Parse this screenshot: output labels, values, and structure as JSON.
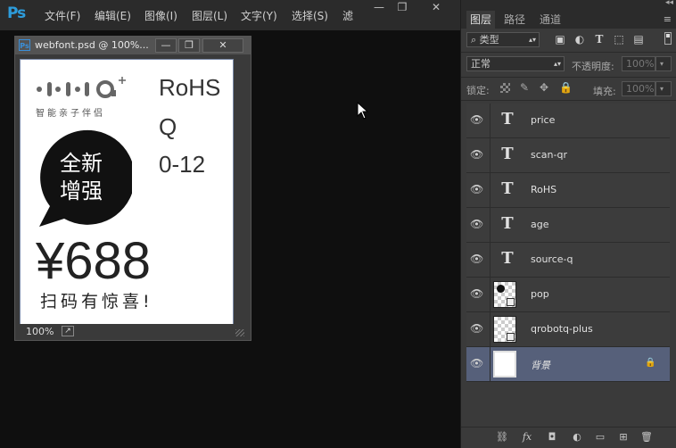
{
  "app": {
    "logo": "Ps",
    "menu": [
      "文件(F)",
      "编辑(E)",
      "图像(I)",
      "图层(L)",
      "文字(Y)",
      "选择(S)",
      "滤"
    ]
  },
  "window_controls": {
    "minimize": "—",
    "restore": "❐",
    "close": "✕"
  },
  "document": {
    "title": "webfont.psd @ 100%...",
    "zoom": "100%",
    "canvas": {
      "brand_tag": "智能亲子伴侣",
      "rohs": "RoHS",
      "q": "Q",
      "age": "0-12",
      "bubble_line1": "全新",
      "bubble_line2": "增强",
      "price": "¥688",
      "scan_text": "扫码有惊喜!"
    }
  },
  "layers_panel": {
    "tabs": [
      "图层",
      "路径",
      "通道"
    ],
    "active_tab": "图层",
    "filter_label": "类型",
    "blend_mode": "正常",
    "opacity_label": "不透明度:",
    "opacity_value": "100%",
    "lock_label": "锁定:",
    "fill_label": "填充:",
    "fill_value": "100%",
    "layers": [
      {
        "name": "price",
        "kind": "text"
      },
      {
        "name": "scan-qr",
        "kind": "text"
      },
      {
        "name": "RoHS",
        "kind": "text"
      },
      {
        "name": "age",
        "kind": "text"
      },
      {
        "name": "source-q",
        "kind": "text"
      },
      {
        "name": "pop",
        "kind": "image"
      },
      {
        "name": "qrobotq-plus",
        "kind": "image"
      },
      {
        "name": "背景",
        "kind": "background",
        "selected": true,
        "locked": true
      }
    ],
    "bottom_icons": [
      "link-icon",
      "fx-icon",
      "mask-icon",
      "adjustment-icon",
      "group-icon",
      "new-layer-icon",
      "trash-icon"
    ],
    "bottom_glyphs": [
      "⛓",
      "fx",
      "◘",
      "◐",
      "▭",
      "⊞",
      "🗑"
    ]
  },
  "colors": {
    "accent": "#2d9cdb",
    "selected_layer": "#56607a",
    "canvas_text": "#333333"
  }
}
